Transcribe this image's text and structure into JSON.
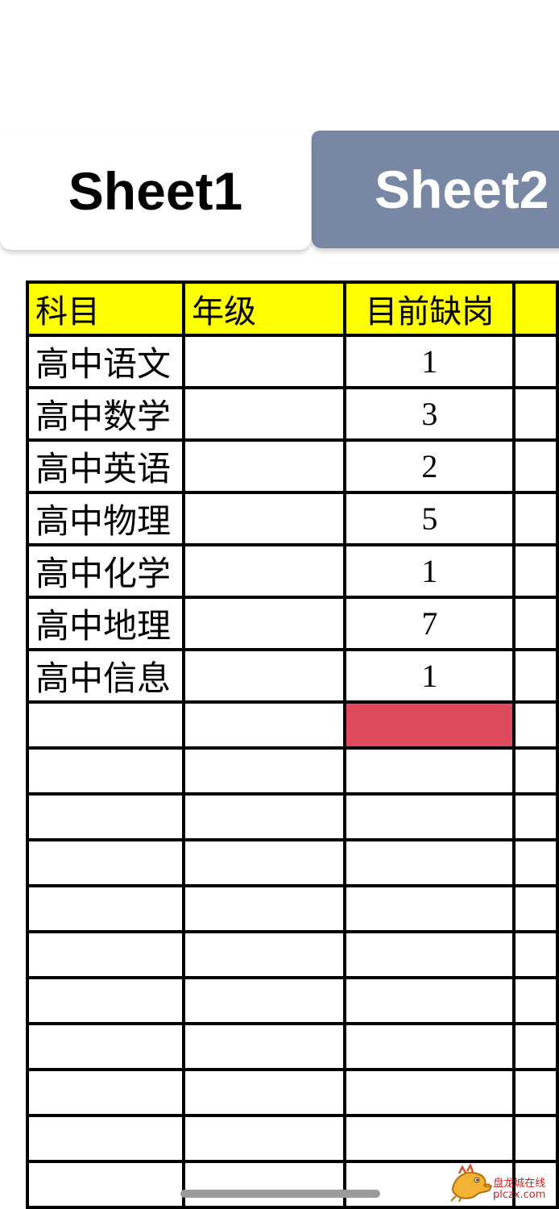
{
  "tabs": [
    {
      "label": "Sheet1",
      "active": true,
      "bg": "#ffffff"
    },
    {
      "label": "Sheet2",
      "active": false,
      "bg": "#7888a4"
    }
  ],
  "colors": {
    "header_fill": "#ffff00",
    "highlight_cell": "#e04b5c",
    "grid_line": "#000000"
  },
  "table": {
    "headers": [
      "科目",
      "年级",
      "目前缺岗",
      ""
    ],
    "rows": [
      {
        "subject": "高中语文",
        "grade": "",
        "vacancies": "1"
      },
      {
        "subject": "高中数学",
        "grade": "",
        "vacancies": "3"
      },
      {
        "subject": "高中英语",
        "grade": "",
        "vacancies": "2"
      },
      {
        "subject": "高中物理",
        "grade": "",
        "vacancies": "5"
      },
      {
        "subject": "高中化学",
        "grade": "",
        "vacancies": "1"
      },
      {
        "subject": "高中地理",
        "grade": "",
        "vacancies": "7"
      },
      {
        "subject": "高中信息",
        "grade": "",
        "vacancies": "1"
      }
    ],
    "blank_rows": 11,
    "highlighted_blank_row": 1,
    "highlighted_column": "目前缺岗"
  },
  "watermark": {
    "icon": "dragon-logo-icon",
    "line1": "盘龙城在线",
    "line2": "plczx.com"
  }
}
